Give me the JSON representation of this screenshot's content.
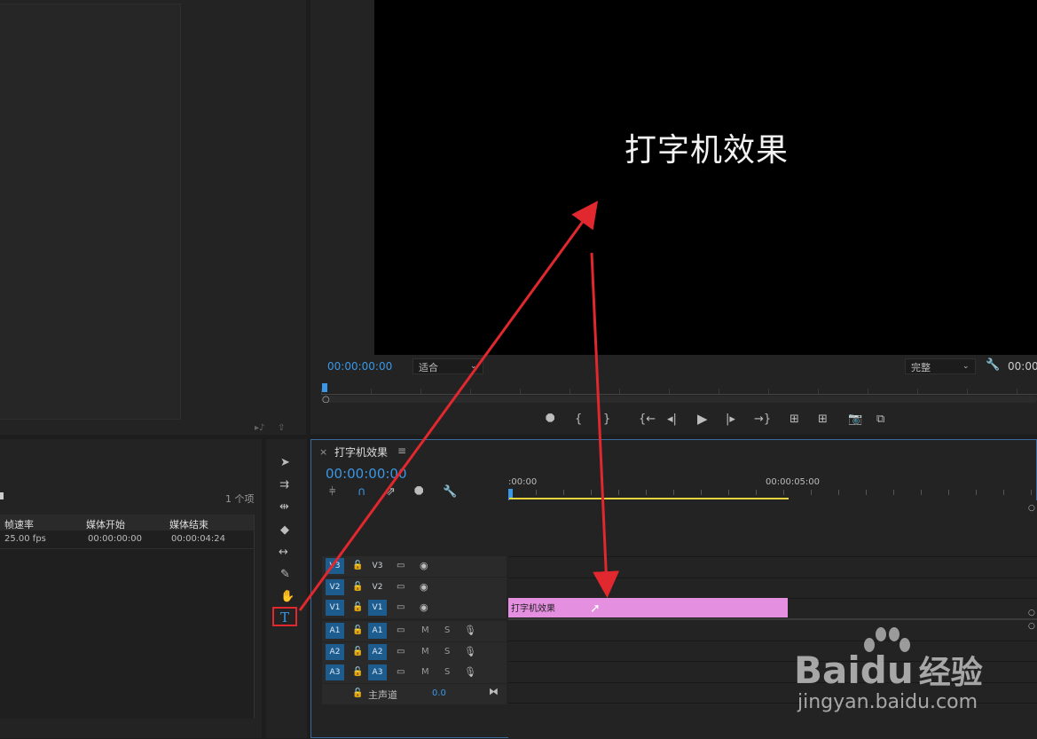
{
  "program": {
    "timecode": "00:00:00:00",
    "zoom_select": "适合",
    "quality_select": "完整",
    "timecode_right": "00:00",
    "preview_text": "打字机效果"
  },
  "project": {
    "item_count": "1 个项",
    "columns": [
      "帧速率",
      "媒体开始",
      "媒体结束"
    ],
    "row": {
      "fps": "25.00 fps",
      "start": "00:00:00:00",
      "end": "00:00:04:24"
    }
  },
  "timeline": {
    "close_label": "×",
    "tab_title": "打字机效果",
    "menu_label": "≡",
    "timecode": "00:00:00:00",
    "ruler_start": ":00:00",
    "ruler_mark": "00:00:05:00",
    "clip_label": "打字机效果",
    "clip_color": "#e58fe0",
    "video_tracks": [
      {
        "src": "V3",
        "name": "V3"
      },
      {
        "src": "V2",
        "name": "V2"
      },
      {
        "src": "V1",
        "name": "V1"
      }
    ],
    "audio_tracks": [
      {
        "src": "A1",
        "name": "A1",
        "m": "M",
        "s": "S"
      },
      {
        "src": "A2",
        "name": "A2",
        "m": "M",
        "s": "S"
      },
      {
        "src": "A3",
        "name": "A3",
        "m": "M",
        "s": "S"
      }
    ],
    "master_label": "主声道",
    "master_value": "0.0"
  },
  "watermark": {
    "brand": "Bai",
    "brand2": "du",
    "suffix": "经验",
    "url": "jingyan.baidu.com"
  },
  "colors": {
    "accent": "#3a97e6",
    "annotation": "#e0282e",
    "work_area": "#e6d23a"
  }
}
